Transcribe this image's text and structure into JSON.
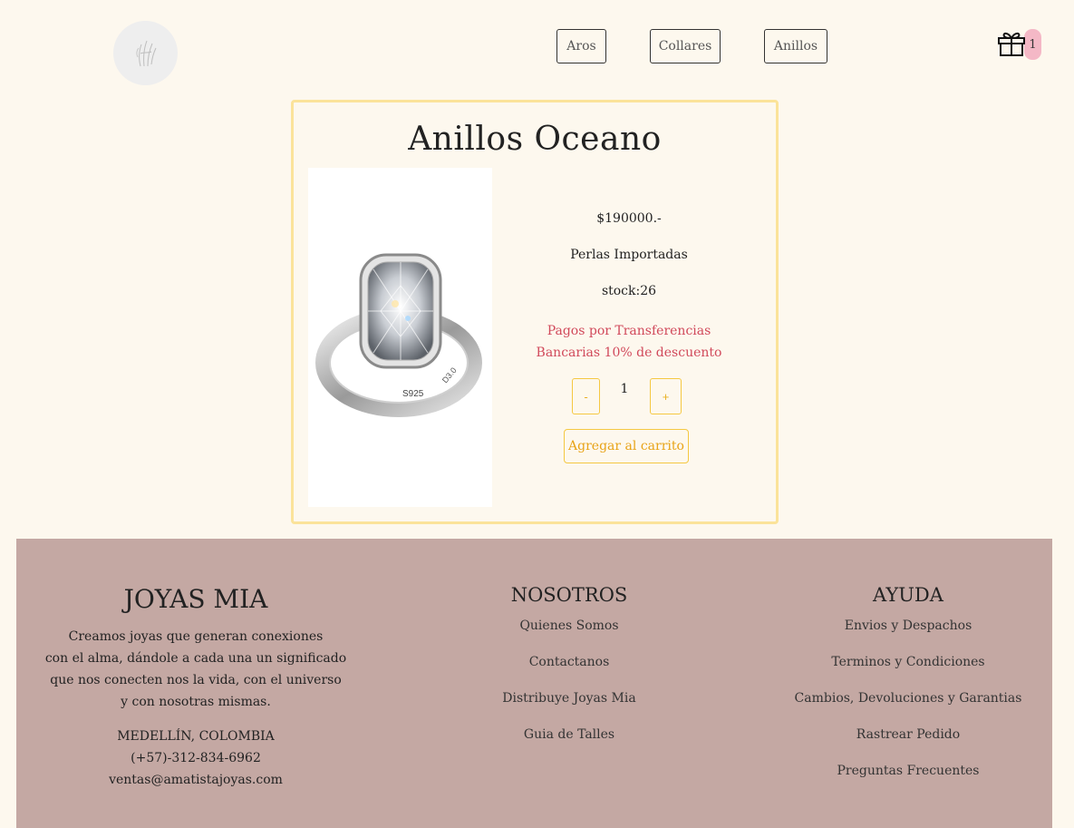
{
  "header": {
    "nav": [
      "Aros",
      "Collares",
      "Anillos"
    ],
    "cart_count": "1"
  },
  "product": {
    "title": "Anillos Oceano",
    "price": "$190000.-",
    "material": "Perlas Importadas",
    "stock": "stock:26",
    "promo_line1": "Pagos por Transferencias",
    "promo_line2": "Bancarias 10% de descuento",
    "qty_minus": "-",
    "qty_value": "1",
    "qty_plus": "+",
    "add_to_cart": "Agregar al carrito",
    "image_engraving_1": "S925",
    "image_engraving_2": "D3.0"
  },
  "footer": {
    "brand": {
      "title": "JOYAS MIA",
      "desc_lines": [
        "Creamos joyas que generan conexiones",
        "con el alma, dándole a cada una un significado",
        "que nos conecten nos la vida, con el universo",
        "y con nosotras mismas."
      ],
      "city": "MEDELLÍN, COLOMBIA",
      "phone": "(+57)-312-834-6962",
      "email": "ventas@amatistajoyas.com"
    },
    "nosotros": {
      "title": "NOSOTROS",
      "links": [
        "Quienes Somos",
        "Contactanos",
        "Distribuye Joyas Mia",
        "Guia de Talles"
      ]
    },
    "ayuda": {
      "title": "AYUDA",
      "links": [
        "Envios y Despachos",
        "Terminos y Condiciones",
        "Cambios, Devoluciones y Garantias",
        "Rastrear Pedido",
        "Preguntas Frecuentes"
      ]
    }
  },
  "colors": {
    "background": "#fdf8ee",
    "card_border": "#fbe39a",
    "accent_gold": "#e8a317",
    "promo_red": "#d1495b",
    "footer_bg": "#c4a8a3",
    "badge_pink": "#f4b8c6"
  },
  "icons": {
    "logo": "hand-sketch-logo",
    "cart": "gift-icon"
  }
}
